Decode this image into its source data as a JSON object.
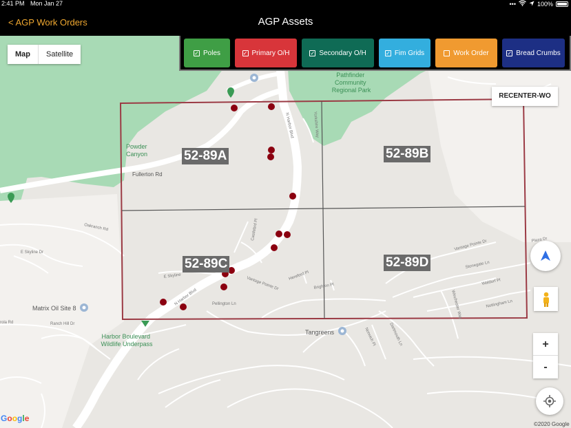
{
  "status": {
    "time": "2:41 PM",
    "date": "Mon Jan 27",
    "dots": "•••",
    "battery": "100%"
  },
  "nav": {
    "back_label": "< AGP Work Orders",
    "title": "AGP Assets"
  },
  "map_type": {
    "map_label": "Map",
    "satellite_label": "Satellite",
    "selected": "Map"
  },
  "layers": [
    {
      "label": "Poles",
      "checked": true,
      "color": "#3f9e45"
    },
    {
      "label": "Primary O/H",
      "checked": true,
      "color": "#d8353a"
    },
    {
      "label": "Secondary O/H",
      "checked": true,
      "color": "#0f6b55"
    },
    {
      "label": "Fim Grids",
      "checked": true,
      "color": "#33aede"
    },
    {
      "label": "Work Order",
      "checked": false,
      "color": "#f09a30"
    },
    {
      "label": "Bread Crumbs",
      "checked": true,
      "color": "#1d2f84"
    }
  ],
  "recenter_label": "RECENTER-WO",
  "grids": [
    "52-89A",
    "52-89B",
    "52-89C",
    "52-89D"
  ],
  "place_labels": {
    "park": "Pathfinder\nCommunity\nRegional Park",
    "powder_canyon": "Powder\nCanyon",
    "fullerton": "Fullerton Rd",
    "matrix": "Matrix Oil Site 8",
    "harbor_underpass": "Harbor Boulevard\nWildlife Underpass",
    "tangreens": "Tangreens"
  },
  "street_labels": {
    "n_harbor_1": "N Harbor Blvd",
    "n_harbor_2": "N Harbor Blvd",
    "vantage_1": "Vantage Pointe Dr",
    "vantage_2": "Vantage Pointe Dr",
    "e_skyline": "E Skyline Dr",
    "skyline": "E Skyline",
    "oakranch": "Oakranch Rd",
    "ranch_hill": "Ranch Hill Dr",
    "stonegate": "Stonegate Ln",
    "waldorf": "Waldorf Pl",
    "nottingham": "Nottingham Ln",
    "winchester": "Winchester Way",
    "dartmouth": "Dartmouth Ln",
    "norwich": "Norwich Pl",
    "hereford": "Hereford Pl",
    "brighton": "Brighton Pl",
    "pellington": "Pellington Ln",
    "castlebrd": "Castlebrd Pl",
    "yorkshire": "Yorkshire Way",
    "plaza": "Plaza Dr",
    "rolla": "rola Rd"
  },
  "zoom": {
    "in": "+",
    "out": "-"
  },
  "google_letters": [
    "G",
    "o",
    "o",
    "g",
    "l",
    "e"
  ],
  "copyright": "©2020 Google",
  "colors": {
    "grid_border": "#9b3a44",
    "pole_marker": "#8b0010",
    "road": "#ffffff",
    "park_green": "#a8dab5",
    "accent": "#f0a830"
  }
}
